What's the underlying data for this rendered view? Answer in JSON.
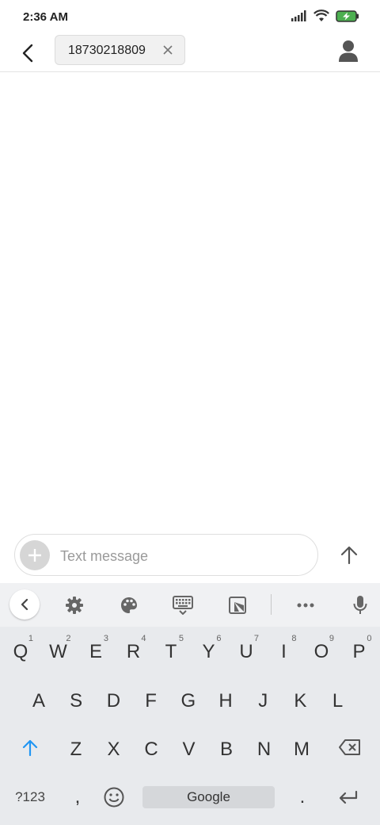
{
  "status_bar": {
    "time": "2:36 AM"
  },
  "header": {
    "recipient": "18730218809"
  },
  "compose": {
    "placeholder": "Text message"
  },
  "keyboard": {
    "row1": [
      {
        "key": "Q",
        "hint": "1"
      },
      {
        "key": "W",
        "hint": "2"
      },
      {
        "key": "E",
        "hint": "3"
      },
      {
        "key": "R",
        "hint": "4"
      },
      {
        "key": "T",
        "hint": "5"
      },
      {
        "key": "Y",
        "hint": "6"
      },
      {
        "key": "U",
        "hint": "7"
      },
      {
        "key": "I",
        "hint": "8"
      },
      {
        "key": "O",
        "hint": "9"
      },
      {
        "key": "P",
        "hint": "0"
      }
    ],
    "row2": [
      "A",
      "S",
      "D",
      "F",
      "G",
      "H",
      "J",
      "K",
      "L"
    ],
    "row3": [
      "Z",
      "X",
      "C",
      "V",
      "B",
      "N",
      "M"
    ],
    "symbols_label": "?123",
    "comma_label": ",",
    "space_label": "Google",
    "period_label": "."
  },
  "colors": {
    "accent": "#2196f3",
    "battery": "#4caf50"
  }
}
